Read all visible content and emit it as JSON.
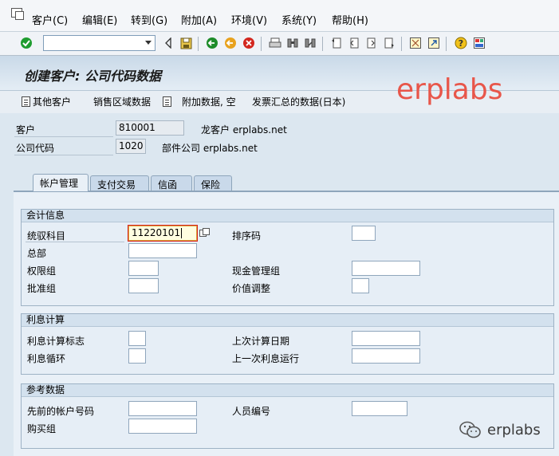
{
  "menu": {
    "items": [
      "客户(C)",
      "编辑(E)",
      "转到(G)",
      "附加(A)",
      "环境(V)",
      "系统(Y)",
      "帮助(H)"
    ]
  },
  "toolbar": {
    "command_value": ""
  },
  "screen": {
    "title": "创建客户: 公司代码数据"
  },
  "app_toolbar": {
    "other_customer": "其他客户",
    "sales_area_data": "销售区域数据",
    "additional_data": "附加数据, 空",
    "invoice_summary": "发票汇总的数据(日本)"
  },
  "watermark": "erplabs",
  "header": {
    "customer_label": "客户",
    "customer_value": "810001",
    "customer_name": "龙客户 erplabs.net",
    "company_label": "公司代码",
    "company_value": "1020",
    "company_name": "部件公司 erplabs.net"
  },
  "tabs": [
    "帐户管理",
    "支付交易",
    "信函",
    "保险"
  ],
  "groups": {
    "accounting": {
      "title": "会计信息",
      "recon_account_label": "统驭科目",
      "recon_account_value": "11220101",
      "sort_key_label": "排序码",
      "head_office_label": "总部",
      "auth_group_label": "权限组",
      "cash_mgmt_group_label": "现金管理组",
      "release_group_label": "批准组",
      "value_adjust_label": "价值调整"
    },
    "interest": {
      "title": "利息计算",
      "indicator_label": "利息计算标志",
      "last_key_date_label": "上次计算日期",
      "cycle_label": "利息循环",
      "last_run_label": "上一次利息运行"
    },
    "reference": {
      "title": "参考数据",
      "prev_account_label": "先前的帐户号码",
      "personnel_no_label": "人员编号",
      "buying_group_label": "购买组"
    }
  },
  "footer_brand": "erplabs"
}
